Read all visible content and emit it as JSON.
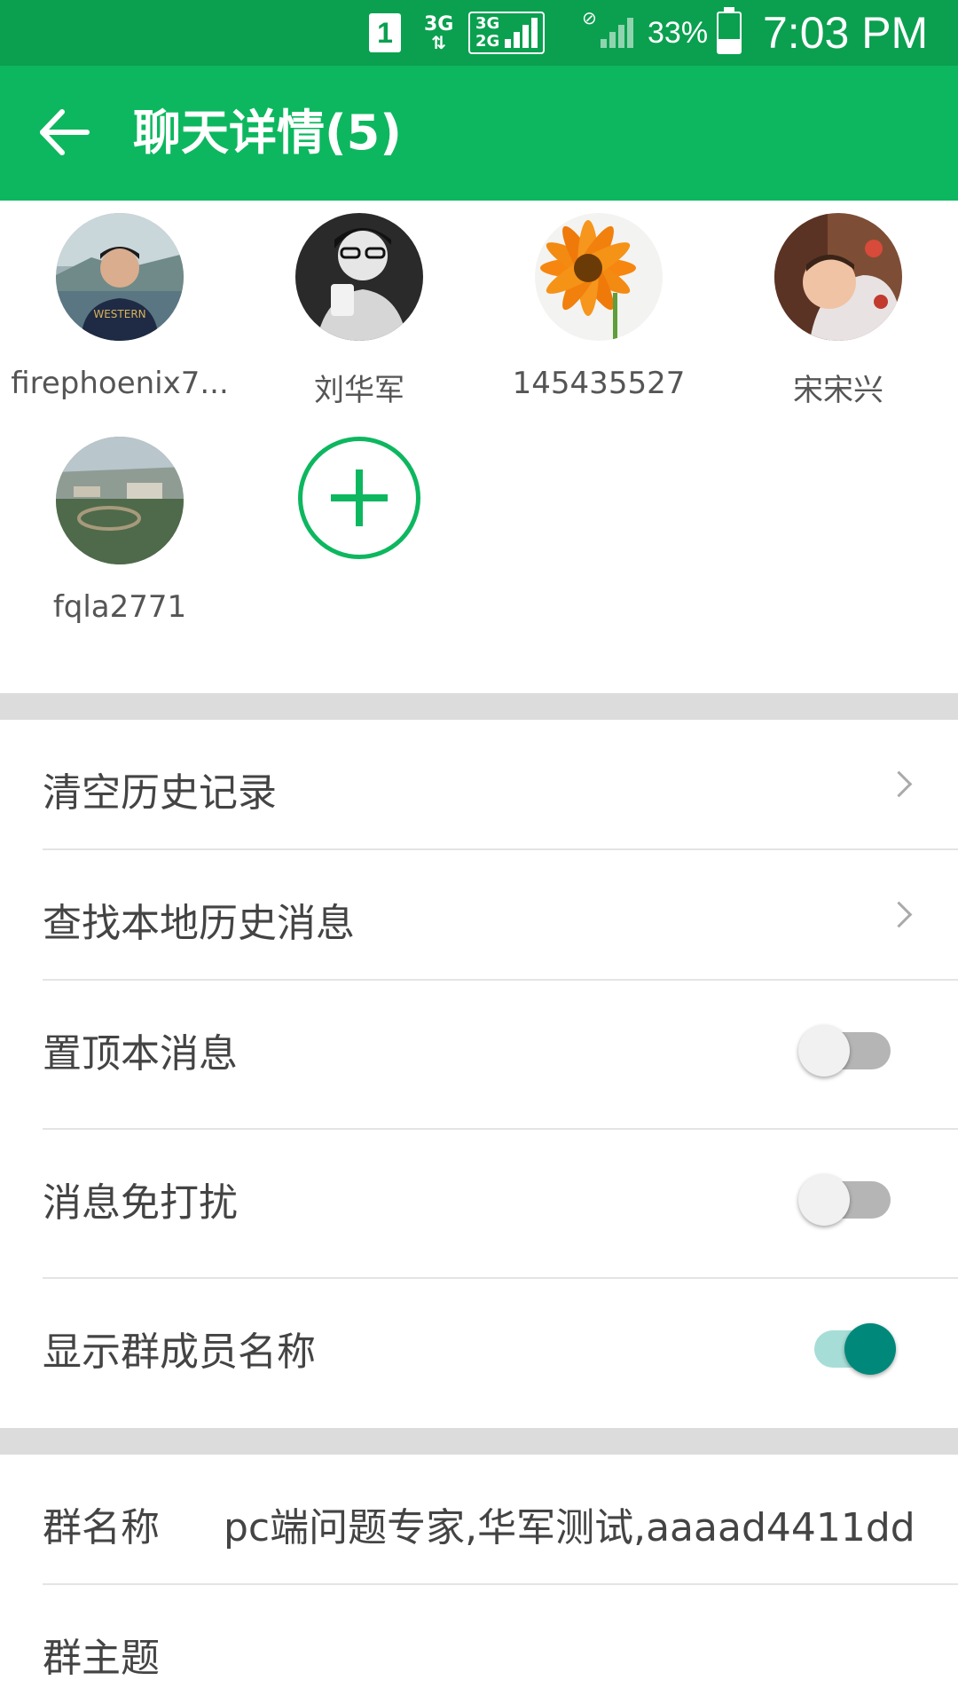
{
  "status_bar": {
    "sim_slot": "1",
    "network_type": "3G",
    "network_box_top": "3G",
    "network_box_bottom": "2G",
    "battery_percent": "33%",
    "battery_level": 0.33,
    "time": "7:03 PM"
  },
  "app_bar": {
    "title": "聊天详情(5)",
    "back_icon": "arrow-left-icon"
  },
  "members": [
    {
      "name": "firephoenix7...",
      "avatar": "avatar-photo-man"
    },
    {
      "name": "刘华军",
      "avatar": "avatar-photo-bw"
    },
    {
      "name": "145435527",
      "avatar": "avatar-photo-flower"
    },
    {
      "name": "宋宋兴",
      "avatar": "avatar-photo-baby"
    },
    {
      "name": "fqla2771",
      "avatar": "avatar-photo-aerial"
    }
  ],
  "add_member_icon": "plus-circle-icon",
  "settings": {
    "clear_history": "清空历史记录",
    "search_local": "查找本地历史消息",
    "pin_chat": {
      "label": "置顶本消息",
      "on": false
    },
    "do_not_disturb": {
      "label": "消息免打扰",
      "on": false
    },
    "show_member_names": {
      "label": "显示群成员名称",
      "on": true
    }
  },
  "group_info": {
    "name_label": "群名称",
    "name_value": "pc端问题专家,华军测试,aaaad4411dd",
    "topic_label": "群主题"
  },
  "colors": {
    "primary": "#0db75f",
    "status_bar": "#0aa04f",
    "toggle_on": "#00897b",
    "toggle_on_track": "#a6ded7"
  }
}
